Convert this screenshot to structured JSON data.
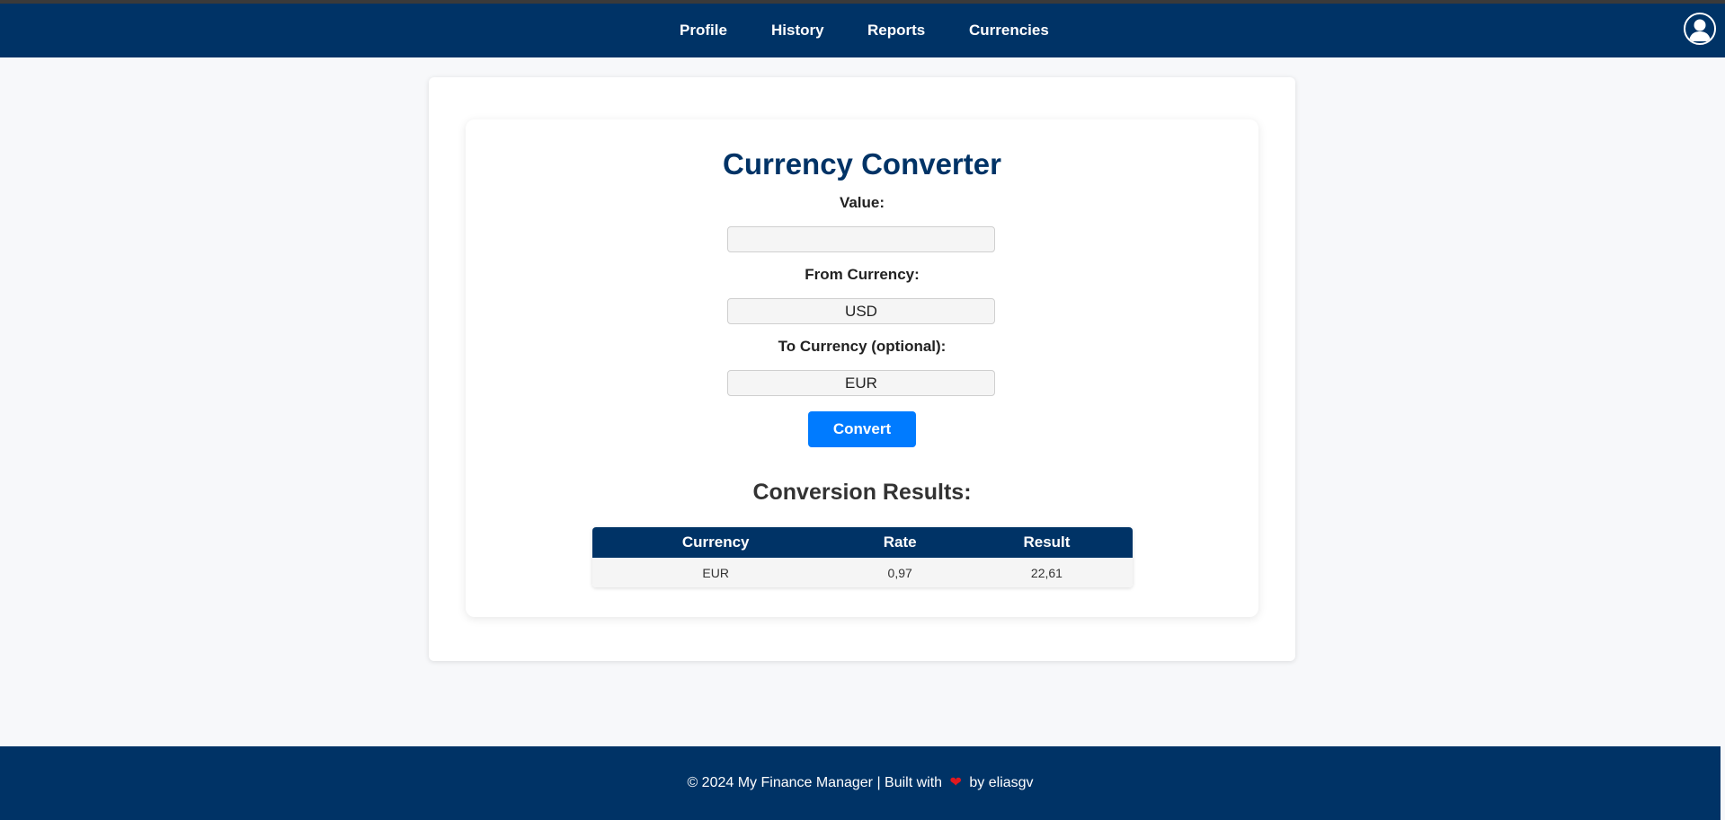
{
  "nav": {
    "items": [
      {
        "label": "Profile"
      },
      {
        "label": "History"
      },
      {
        "label": "Reports"
      },
      {
        "label": "Currencies"
      }
    ]
  },
  "icons": {
    "profile": "user-avatar-icon",
    "heart": "heart-icon"
  },
  "converter": {
    "title": "Currency Converter",
    "value_label": "Value:",
    "value": "",
    "from_label": "From Currency:",
    "from_value": "USD",
    "to_label": "To Currency (optional):",
    "to_value": "EUR",
    "convert_label": "Convert"
  },
  "results": {
    "title": "Conversion Results:",
    "columns": [
      "Currency",
      "Rate",
      "Result"
    ],
    "rows": [
      [
        "EUR",
        "0,97",
        "22,61"
      ]
    ]
  },
  "footer": {
    "prefix": "© 2024 My Finance Manager | Built with",
    "heart": "❤",
    "suffix": "by eliasgv"
  },
  "colors": {
    "primary": "#003366",
    "button": "#007bff",
    "background": "#f7f8fa",
    "heart": "#e0191f"
  }
}
